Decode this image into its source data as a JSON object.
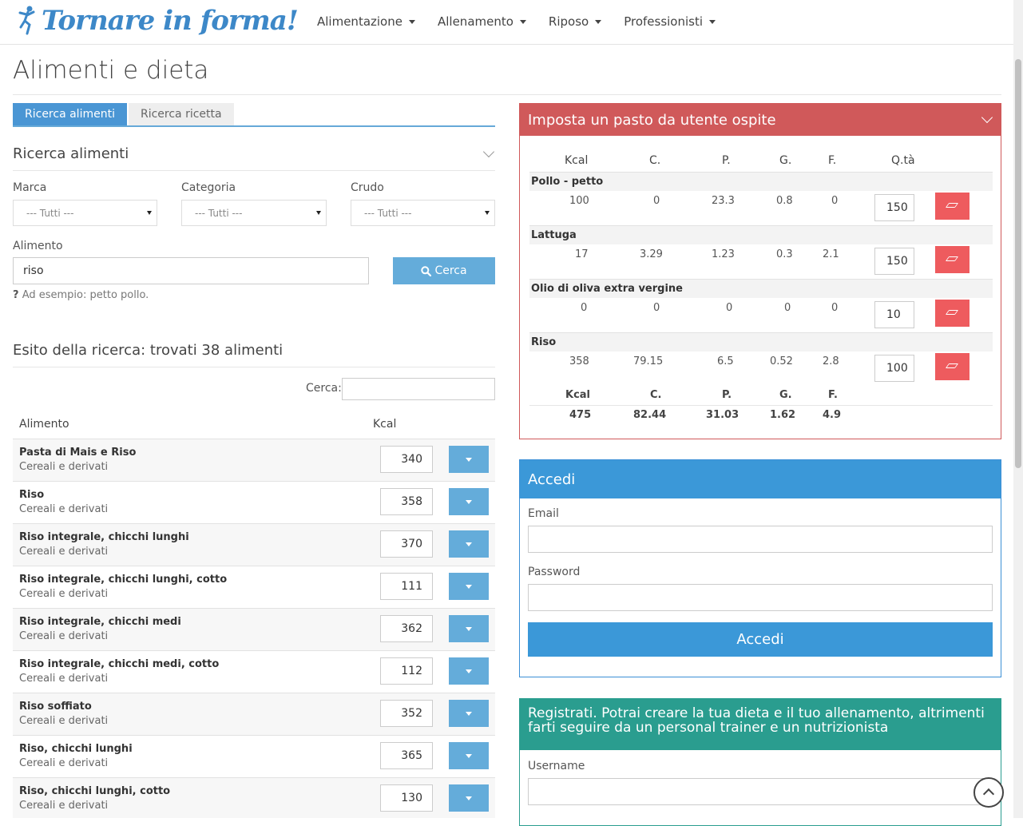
{
  "header": {
    "logo_text": "Tornare in forma!",
    "nav": [
      "Alimentazione",
      "Allenamento",
      "Riposo",
      "Professionisti"
    ]
  },
  "page_title": "Alimenti e dieta",
  "tabs": [
    "Ricerca alimenti",
    "Ricerca ricetta"
  ],
  "search": {
    "title": "Ricerca alimenti",
    "marca_label": "Marca",
    "marca_value": "--- Tutti ---",
    "categoria_label": "Categoria",
    "categoria_value": "--- Tutti ---",
    "crudo_label": "Crudo",
    "crudo_value": "--- Tutti ---",
    "alimento_label": "Alimento",
    "alimento_value": "riso",
    "button": "Cerca",
    "help_mark": "?",
    "help_text": "Ad esempio: petto pollo."
  },
  "results": {
    "title": "Esito della ricerca: trovati 38 alimenti",
    "filter_label": "Cerca:",
    "filter_value": "",
    "col_food": "Alimento",
    "col_kcal": "Kcal",
    "rows": [
      {
        "name": "Pasta di Mais e Riso",
        "category": "Cereali e derivati",
        "kcal": "340"
      },
      {
        "name": "Riso",
        "category": "Cereali e derivati",
        "kcal": "358"
      },
      {
        "name": "Riso integrale, chicchi lunghi",
        "category": "Cereali e derivati",
        "kcal": "370"
      },
      {
        "name": "Riso integrale, chicchi lunghi, cotto",
        "category": "Cereali e derivati",
        "kcal": "111"
      },
      {
        "name": "Riso integrale, chicchi medi",
        "category": "Cereali e derivati",
        "kcal": "362"
      },
      {
        "name": "Riso integrale, chicchi medi, cotto",
        "category": "Cereali e derivati",
        "kcal": "112"
      },
      {
        "name": "Riso soffiato",
        "category": "Cereali e derivati",
        "kcal": "352"
      },
      {
        "name": "Riso, chicchi lunghi",
        "category": "Cereali e derivati",
        "kcal": "365"
      },
      {
        "name": "Riso, chicchi lunghi, cotto",
        "category": "Cereali e derivati",
        "kcal": "130"
      }
    ]
  },
  "meal": {
    "title": "Imposta un pasto da utente ospite",
    "headers": {
      "kcal": "Kcal",
      "c": "C.",
      "p": "P.",
      "g": "G.",
      "f": "F.",
      "qta": "Q.tà"
    },
    "items": [
      {
        "name": "Pollo - petto",
        "kcal": "100",
        "c": "0",
        "p": "23.3",
        "g": "0.8",
        "f": "0",
        "qty": "150"
      },
      {
        "name": "Lattuga",
        "kcal": "17",
        "c": "3.29",
        "p": "1.23",
        "g": "0.3",
        "f": "2.1",
        "qty": "150"
      },
      {
        "name": "Olio di oliva extra vergine",
        "kcal": "0",
        "c": "0",
        "p": "0",
        "g": "0",
        "f": "0",
        "qty": "10"
      },
      {
        "name": "Riso",
        "kcal": "358",
        "c": "79.15",
        "p": "6.5",
        "g": "0.52",
        "f": "2.8",
        "qty": "100"
      }
    ],
    "totals": {
      "kcal": "475",
      "c": "82.44",
      "p": "31.03",
      "g": "1.62",
      "f": "4.9"
    }
  },
  "login": {
    "title": "Accedi",
    "email_label": "Email",
    "email_value": "",
    "password_label": "Password",
    "password_value": "",
    "button": "Accedi"
  },
  "register": {
    "title": "Registrati. Potrai creare la tua dieta e il tuo allenamento, altrimenti farti seguire da un personal trainer e un nutrizionista",
    "username_label": "Username",
    "username_value": ""
  },
  "colors": {
    "brand_blue": "#3d88c8",
    "tab_active": "#4a96d4",
    "button_blue": "#64acda",
    "meal_red": "#d0595a",
    "delete_red": "#ee5b5e",
    "login_blue": "#3b98d8",
    "register_teal": "#2a9d8f"
  },
  "icons": [
    "runner-logo-icon",
    "caret-down-icon",
    "chevron-down-icon",
    "search-icon",
    "eraser-icon",
    "chevron-up-icon"
  ]
}
